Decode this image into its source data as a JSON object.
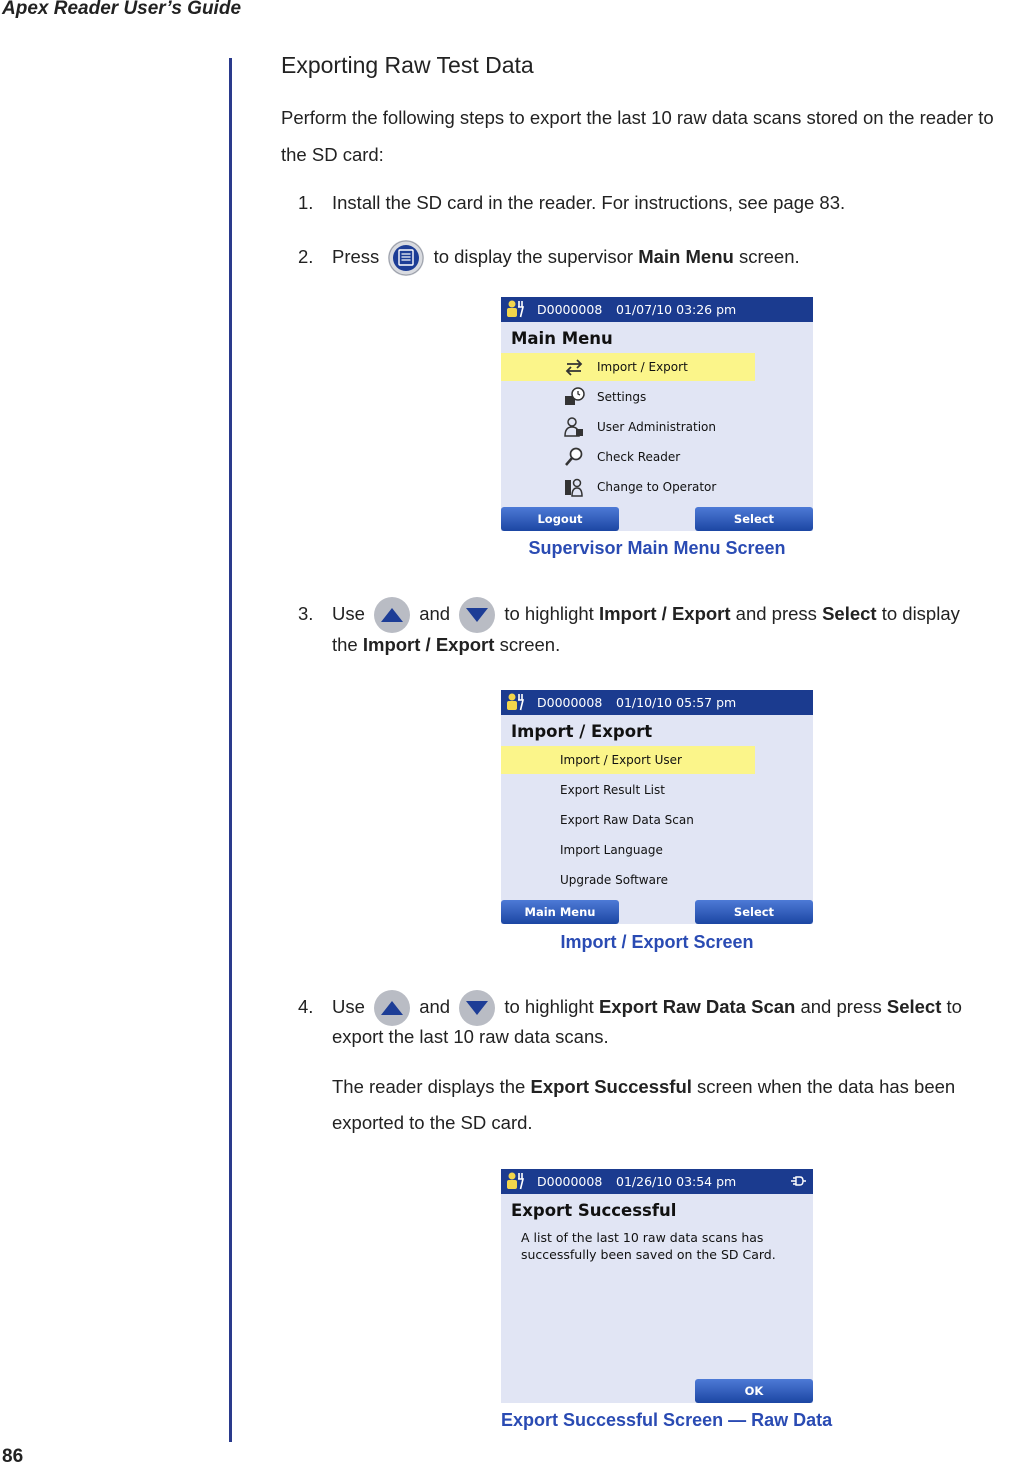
{
  "header": {
    "running_head": "Apex Reader User’s Guide",
    "page_number": "86"
  },
  "section_title": "Exporting Raw Test Data",
  "intro": "Perform the following steps to export the last 10 raw data scans stored on the reader to the SD card:",
  "steps": [
    {
      "num": "1.",
      "text": "Install the SD card in the reader. For instructions, see page 83."
    },
    {
      "num": "2.",
      "pre": "Press",
      "mid": "to display the supervisor",
      "bold": "Main Menu",
      "post": "screen."
    },
    {
      "num": "3.",
      "pre": "Use",
      "and": "and",
      "mid": "to highlight",
      "bold1": "Import / Export",
      "mid2": "and press",
      "bold2": "Select",
      "post": "to display",
      "line2_pre": "the",
      "line2_bold": "Import / Export",
      "line2_post": "screen."
    },
    {
      "num": "4.",
      "pre": "Use",
      "and": "and",
      "mid": "to highlight",
      "bold1": "Export Raw Data Scan",
      "mid2": "and press",
      "bold2": "Select",
      "post": "to",
      "line2": "export the last 10 raw data scans.",
      "note_pre": "The reader displays the",
      "note_bold": "Export Successful",
      "note_post": "screen when the data has been",
      "note_line2": "exported to the SD card."
    }
  ],
  "icons": {
    "menu_button": "menu-list-icon",
    "up_button": "up-arrow-icon",
    "down_button": "down-arrow-icon"
  },
  "screens": [
    {
      "id": "D0000008",
      "datetime": "01/07/10  03:26 pm",
      "title": "Main Menu",
      "items": [
        "Import / Export",
        "Settings",
        "User Administration",
        "Check Reader",
        "Change to Operator"
      ],
      "highlighted_index": 0,
      "left_button": "Logout",
      "right_button": "Select",
      "caption": "Supervisor Main Menu Screen"
    },
    {
      "id": "D0000008",
      "datetime": "01/10/10  05:57 pm",
      "title": "Import / Export",
      "items": [
        "Import / Export User",
        "Export Result List",
        "Export Raw Data Scan",
        "Import Language",
        "Upgrade Software"
      ],
      "highlighted_index": 0,
      "left_button": "Main Menu",
      "right_button": "Select",
      "caption": "Import / Export Screen"
    },
    {
      "id": "D0000008",
      "datetime": "01/26/10  03:54 pm",
      "title": "Export Successful",
      "message_line1": "A list of the last 10 raw data scans has",
      "message_line2": "successfully been saved on the SD Card.",
      "right_button": "OK",
      "caption": "Export Successful Screen — Raw Data"
    }
  ],
  "colors": {
    "accent_blue": "#2a4bb3",
    "screen_bar": "#1b3b8f",
    "highlight": "#fbf58a",
    "screen_bg": "#e1e5f4"
  }
}
